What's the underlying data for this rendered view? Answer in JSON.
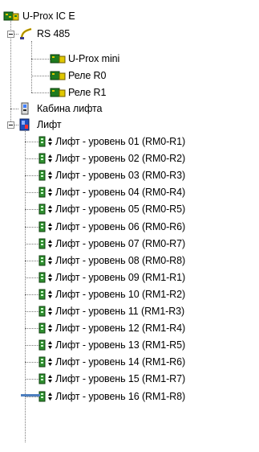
{
  "tree": {
    "root": {
      "label": "U-Prox IC E",
      "icon": "controller-board-icon"
    },
    "bus": {
      "label": "RS 485",
      "icon": "cable-icon",
      "expanded": true,
      "children": [
        {
          "label": "U-Prox mini",
          "icon": "module-board-icon"
        },
        {
          "label": "Реле R0",
          "icon": "module-board-icon"
        },
        {
          "label": "Реле R1",
          "icon": "module-board-icon"
        }
      ]
    },
    "cabin": {
      "label": "Кабина лифта",
      "icon": "cabin-icon"
    },
    "lift": {
      "label": "Лифт",
      "icon": "lift-icon",
      "expanded": true,
      "levels": [
        "Лифт - уровень 01 (RM0-R1)",
        "Лифт - уровень 02 (RM0-R2)",
        "Лифт - уровень 03 (RM0-R3)",
        "Лифт - уровень 04 (RM0-R4)",
        "Лифт - уровень 05 (RM0-R5)",
        "Лифт - уровень 06 (RM0-R6)",
        "Лифт - уровень 07 (RM0-R7)",
        "Лифт - уровень 08 (RM0-R8)",
        "Лифт - уровень 09 (RM1-R1)",
        "Лифт - уровень 10 (RM1-R2)",
        "Лифт - уровень 11 (RM1-R3)",
        "Лифт - уровень 12 (RM1-R4)",
        "Лифт - уровень 13 (RM1-R5)",
        "Лифт - уровень 14 (RM1-R6)",
        "Лифт - уровень 15 (RM1-R7)",
        "Лифт - уровень 16 (RM1-R8)"
      ]
    }
  },
  "colors": {
    "board_green": "#1f7a1f",
    "board_yellow": "#e0c800",
    "lift_blue": "#1f4fbf",
    "level_green": "#2f8f2f",
    "accent_blue": "#4d7fbf"
  }
}
